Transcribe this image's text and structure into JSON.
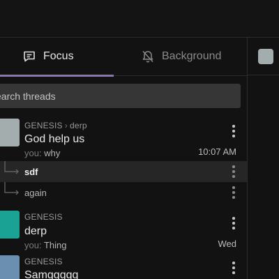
{
  "tabs": {
    "focus_label": "Focus",
    "background_label": "Background"
  },
  "search": {
    "placeholder": "earch threads"
  },
  "threads": [
    {
      "breadcrumb_parent": "GENESIS",
      "breadcrumb_child": "derp",
      "title": "God help us",
      "preview_author": "you:",
      "preview_text": "why",
      "time": "10:07 AM",
      "avatar_color": "#a4adad",
      "replies": [
        {
          "label": "sdf",
          "active": true
        },
        {
          "label": "again",
          "active": false
        }
      ]
    },
    {
      "breadcrumb_parent": "GENESIS",
      "title": "derp",
      "preview_author": "you:",
      "preview_text": "Thing",
      "time": "Wed",
      "avatar_color": "#1aa394"
    },
    {
      "breadcrumb_parent": "GENESIS",
      "title": "Samggggg",
      "avatar_color": "#6a8fb0"
    }
  ],
  "colors": {
    "background": "#121212",
    "tab_indicator": "#8a75b8",
    "search_bg": "#363636",
    "active_row": "#262626"
  },
  "icons": [
    "chat-bubble-icon",
    "bell-off-icon",
    "more-vertical-icon",
    "reply-branch-icon"
  ]
}
